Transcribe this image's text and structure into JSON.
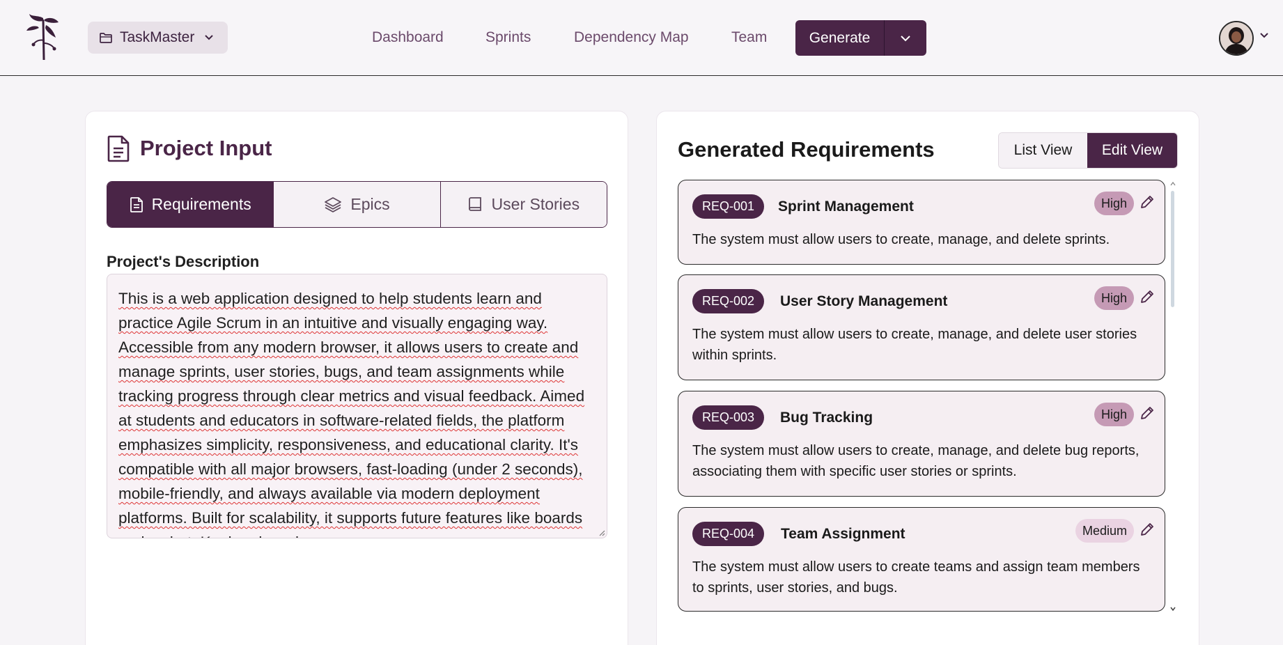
{
  "header": {
    "project_name": "TaskMaster",
    "nav": [
      "Dashboard",
      "Sprints",
      "Dependency Map",
      "Team"
    ],
    "generate_label": "Generate"
  },
  "project_input": {
    "title": "Project Input",
    "tabs": [
      "Requirements",
      "Epics",
      "User Stories"
    ],
    "active_tab": "Requirements",
    "description_label": "Project's Description",
    "description_text": "This is a web application designed to help students learn and practice Agile Scrum in an intuitive and visually engaging way. Accessible from any modern browser, it allows users to create and manage sprints, user stories, bugs, and team assignments while tracking progress through clear metrics and visual feedback. Aimed at students and educators in software-related fields, the platform emphasizes simplicity, responsiveness, and educational clarity. It's compatible with all major browsers, fast-loading (under 2 seconds), mobile-friendly, and always available via modern deployment platforms. Built for scalability, it supports future features like boards and a chat. Kanban boards"
  },
  "requirements": {
    "title": "Generated Requirements",
    "list_view_label": "List View",
    "edit_view_label": "Edit View",
    "active_view": "Edit View",
    "items": [
      {
        "id": "REQ-001",
        "name": "Sprint Management",
        "priority": "High",
        "description": "The system must allow users to create, manage, and delete sprints."
      },
      {
        "id": "REQ-002",
        "name": "User Story Management",
        "priority": "High",
        "description": "The system must allow users to create, manage, and delete user stories within sprints."
      },
      {
        "id": "REQ-003",
        "name": "Bug Tracking",
        "priority": "High",
        "description": "The system must allow users to create, manage, and delete bug reports, associating them with specific user stories or sprints."
      },
      {
        "id": "REQ-004",
        "name": "Team Assignment",
        "priority": "Medium",
        "description": "The system must allow users to create teams and assign team members to sprints, user stories, and bugs."
      }
    ]
  },
  "colors": {
    "brand": "#4a2547",
    "priority_high": "#c59ab5",
    "priority_medium": "#ead3e2"
  }
}
